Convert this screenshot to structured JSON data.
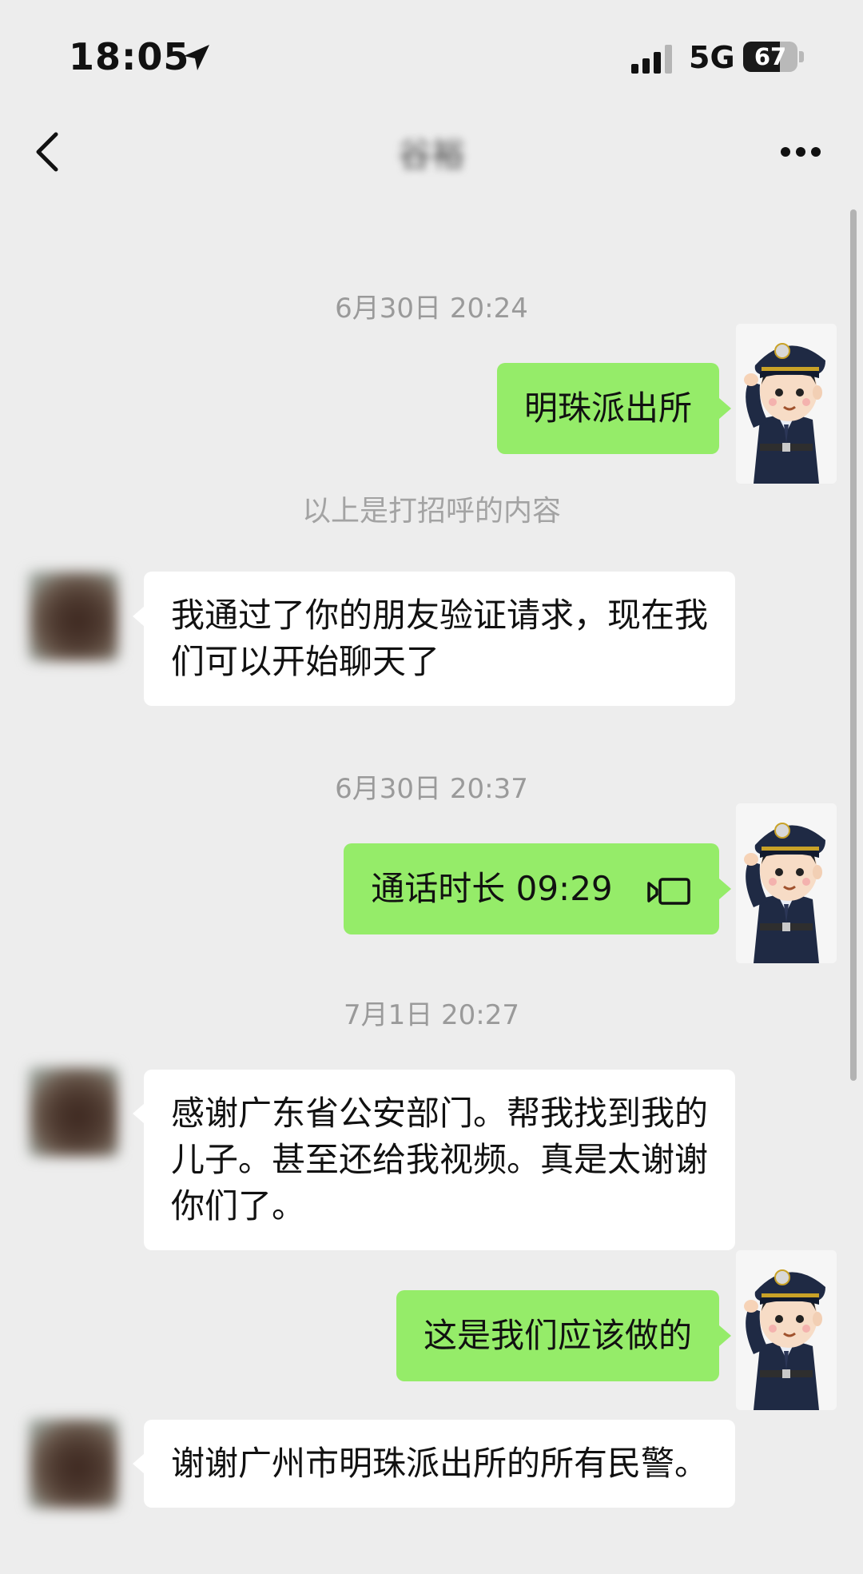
{
  "status_bar": {
    "time": "18:05",
    "network": "5G",
    "battery": "67",
    "battery_level": 0.67
  },
  "nav": {
    "title": "谷裕"
  },
  "messages": {
    "ts1": "6月30日 20:24",
    "sent1": "明珠派出所",
    "note": "以上是打招呼的内容",
    "recv1": "我通过了你的朋友验证请求，现在我们可以开始聊天了",
    "ts2": "6月30日 20:37",
    "call": "通话时长 09:29",
    "ts3": "7月1日 20:27",
    "recv2": "感谢广东省公安部门。帮我找到我的儿子。甚至还给我视频。真是太谢谢你们了。",
    "sent2": "这是我们应该做的",
    "recv3": "谢谢广州市明珠派出所的所有民警。"
  },
  "colors": {
    "background": "#ededed",
    "sent_bubble": "#95ec69",
    "received_bubble": "#ffffff",
    "uniform": "#1f2a44"
  },
  "icons": {
    "location": "location-arrow-icon",
    "signal": "signal-bars-icon",
    "back": "chevron-left-icon",
    "more": "more-dots-icon",
    "call": "video-call-icon"
  }
}
